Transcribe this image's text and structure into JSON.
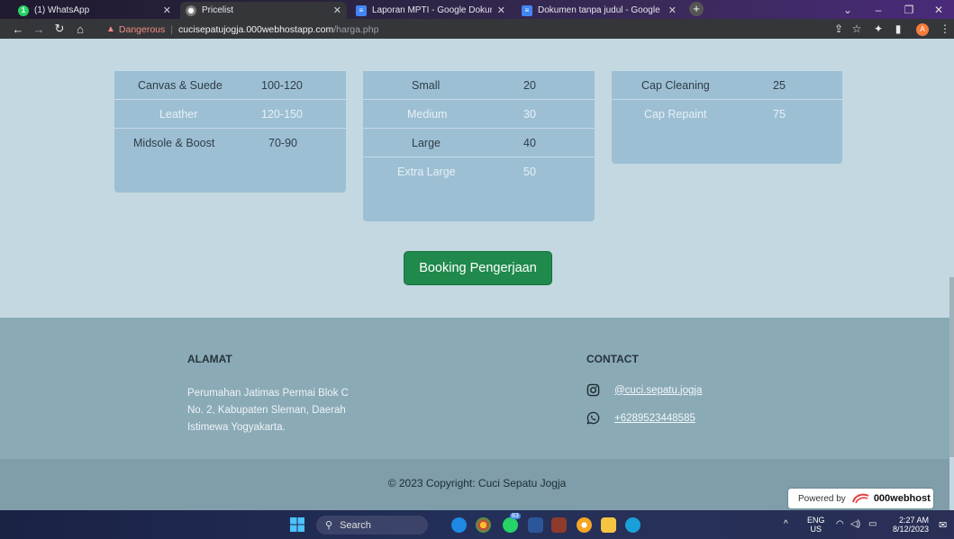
{
  "browser": {
    "tabs": [
      {
        "title": "(1) WhatsApp",
        "icon": "whatsapp-icon",
        "active": false
      },
      {
        "title": "Pricelist",
        "icon": "globe-icon",
        "active": true
      },
      {
        "title": "Laporan MPTI - Google Dokumen",
        "icon": "docs-icon",
        "active": false
      },
      {
        "title": "Dokumen tanpa judul - Google Dokumen",
        "icon": "docs-icon",
        "active": false
      }
    ],
    "new_tab": "+",
    "warning_label": "Dangerous",
    "url_host": "cucisepatujogja.000webhostapp.com",
    "url_path": "/harga.php",
    "profile_initial": "A"
  },
  "tables": {
    "services": [
      {
        "name": "Canvas & Suede",
        "price": "100-120"
      },
      {
        "name": "Leather",
        "price": "120-150"
      },
      {
        "name": "Midsole & Boost",
        "price": "70-90"
      }
    ],
    "sizes": [
      {
        "name": "Small",
        "price": "20"
      },
      {
        "name": "Medium",
        "price": "30"
      },
      {
        "name": "Large",
        "price": "40"
      },
      {
        "name": "Extra Large",
        "price": "50"
      }
    ],
    "caps": [
      {
        "name": "Cap Cleaning",
        "price": "25"
      },
      {
        "name": "Cap Repaint",
        "price": "75"
      }
    ]
  },
  "booking_button": "Booking Pengerjaan",
  "footer": {
    "address_title": "ALAMAT",
    "address_text": "Perumahan Jatimas Permai Blok C No. 2, Kabupaten Sleman, Daerah Istimewa Yogyakarta.",
    "contact_title": "CONTACT",
    "instagram": "@cuci.sepatu.jogja",
    "phone": "+6289523448585",
    "copyright": "© 2023 Copyright: Cuci Sepatu Jogja",
    "powered_by": "Powered by",
    "powered_brand": "000webhost"
  },
  "taskbar": {
    "search_placeholder": "Search",
    "lang": "ENG",
    "region": "US",
    "time": "2:27 AM",
    "date": "8/12/2023",
    "whatsapp_badge": "83"
  },
  "colors": {
    "page_bg": "#c3d8e0",
    "table_bg": "#9dbfd4",
    "button_green": "#1f8a4c",
    "footer_bg": "#8aaab6"
  }
}
